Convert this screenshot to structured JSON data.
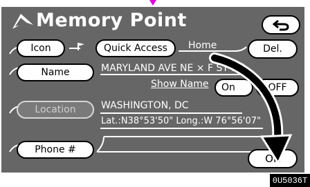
{
  "header": {
    "title": "Memory Point",
    "back_icon": "u-turn-back-icon",
    "logo_icon": "navigation-arrow-icon"
  },
  "buttons": {
    "icon": "Icon",
    "quick_access": "Quick Access",
    "delete": "Del.",
    "name": "Name",
    "location": "Location",
    "phone": "Phone #",
    "off": "OFF",
    "on_partial": "On",
    "ok": "OK"
  },
  "fields": {
    "quick_access_value": "Home",
    "name_value": "MARYLAND AVE NE × F ST NE",
    "show_name_label": "Show Name",
    "location_city": "WASHINGTON, DC",
    "location_coords": "Lat.:N38°53'50\"  Long.:W 76°56'07\""
  },
  "footer": {
    "reference_code": "0U5036T"
  },
  "colors": {
    "panel": "#666666",
    "accent": "#e000e0"
  }
}
